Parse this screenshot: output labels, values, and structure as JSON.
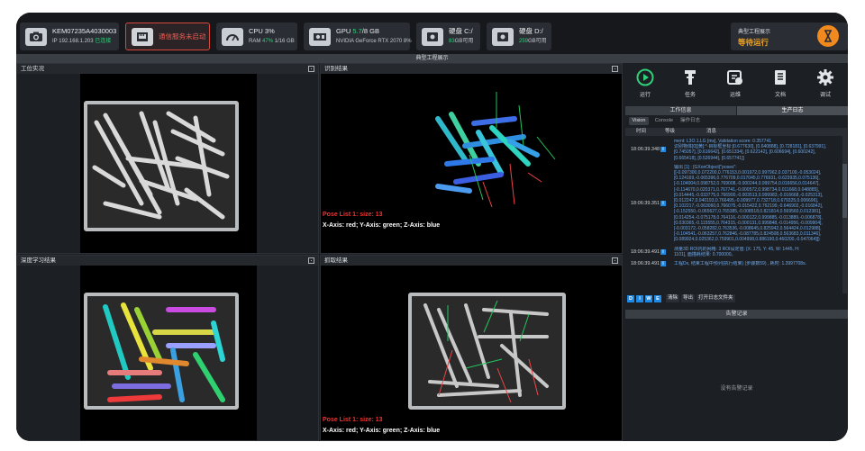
{
  "topbar": {
    "camera": {
      "name": "KEM07235A4030003",
      "ip_label": "IP 192.168.1.203",
      "ip_status": "已连接",
      "icon": "camera-icon"
    },
    "comm": {
      "label": "通信服务未启动",
      "icon": "network-port-icon"
    },
    "cpu": {
      "label": "CPU 3%",
      "ram_prefix": "RAM",
      "ram_value": "47%",
      "ram_suffix": "1/16 GB",
      "icon": "gauge-icon"
    },
    "gpu": {
      "prefix": "GPU",
      "value": "5.7",
      "suffix": "/8 GB",
      "model": "NVIDIA GeForce RTX 2070 8%",
      "icon": "gpu-card-icon"
    },
    "disk_c": {
      "label": "硬盘 C:/",
      "free_value": "83",
      "free_suffix": "GB可用",
      "icon": "harddisk-icon"
    },
    "disk_d": {
      "label": "硬盘 D:/",
      "free_value": "259",
      "free_suffix": "GB可用",
      "icon": "harddisk-icon"
    },
    "status": {
      "title": "典型工程展示",
      "state": "等待运行",
      "icon": "hourglass-icon"
    }
  },
  "project_title": "典型工程展示",
  "panels": {
    "live": {
      "title": "工位实况"
    },
    "recog": {
      "title": "识别结果",
      "pose": "Pose List 1: size: 13",
      "axes": "X-Axis: red; Y-Axis: green; Z-Axis: blue"
    },
    "deep": {
      "title": "深度学习结果"
    },
    "grab": {
      "title": "抓取结果",
      "pose": "Pose List 1: size: 13",
      "axes": "X-Axis: red; Y-Axis: green; Z-Axis: blue"
    }
  },
  "toolbar": [
    {
      "label": "运行",
      "icon": "play-icon"
    },
    {
      "label": "任务",
      "icon": "tool-icon"
    },
    {
      "label": "运维",
      "icon": "maintenance-icon"
    },
    {
      "label": "文档",
      "icon": "document-icon"
    },
    {
      "label": "调试",
      "icon": "gear-icon"
    }
  ],
  "info_tabs": [
    "工作信息",
    "生产日志"
  ],
  "sub_tabs": [
    "Vision",
    "Console",
    "操作日志"
  ],
  "log_columns": [
    "时间",
    "等级",
    "消息"
  ],
  "logs": [
    {
      "time": "18:06:39.348",
      "lines": [
        "ment: L3O.1.LG [ms], Validation score: 0.357741",
        "识别物体[0][黄]:*-目标框坐标:[0.677630], [0.640888], [0.728181], [0.637991],",
        "[0.745057], [0.616642], [0.651334], [0.622142], [0.606694], [0.600242],",
        "[0.665418], [0.526944], [0.657741]]"
      ]
    },
    {
      "time": "18:06:39.351",
      "lines": [
        "输出 [1] : [GXonObject{\"poses\":",
        "[[-0.097300,0.072200,0.776153,0.001972,0.997962,0.037109,-0.053024],",
        "[0.124169,-0.065396,0.776709,0.017045,0.776931,-0.623935,0.075136],",
        "[-0.104004,0.098752,0.769008,-0.000244,0.999754,0.016656,0.014647],",
        "[-0.114670,0.020371,0.767741,-0.000572,0.998734,0.011668,0.048885],",
        "[0.014445,-0.033775,0.766900,-0.003513,0.999983,-0.016668,-0.025313],",
        "[0.012247,0.040193,0.766495,-0.009977,0.732718,0.679325,0.006696],",
        "[0.102217,-0.063060,0.766075,-0.015422,0.762199,-0.646902,-0.016842],",
        "[-0.152550,-0.065627,0.765385,-0.008518,0.821814,0.569560,0.012381],",
        "[0.014254,-0.075178,0.764116,-0.000122,0.999885,-0.013889,-0.006878],",
        "[0.030365,-0.115555,0.764315,-0.000131,0.999848,-0.014956,-0.009904],",
        "[-0.003172,-0.058282,0.763536,-0.008645,0.825942,0.564424,0.012988],",
        "[-0.104541,-0.063257,0.762846,-0.087785,0.824508,0.563683,0.011346],",
        "[0.089924,0.025362,0.759901,0.004998,0.886190,0.460200,-0.047064]]}"
      ]
    },
    {
      "time": "18:06:39.491",
      "lines": [
        "测量3D ROI内的网格: 3 ROI设定值: [X: 175, Y: 45, W: 1445, H:",
        "1101], 面描耗结果: 0.700000。"
      ]
    },
    {
      "time": "18:06:39.491",
      "lines": [
        "工程Dx, 结束工程中预列(执行结束) (步骤数59) , 耗时: 1.3997708s."
      ]
    }
  ],
  "log_controls": {
    "levels": [
      "D",
      "I",
      "W",
      "E"
    ],
    "clear": "清除",
    "export": "导出",
    "open_dir": "打开日志文件夹"
  },
  "alarm": {
    "title": "告警记录",
    "empty": "没有告警记录"
  }
}
